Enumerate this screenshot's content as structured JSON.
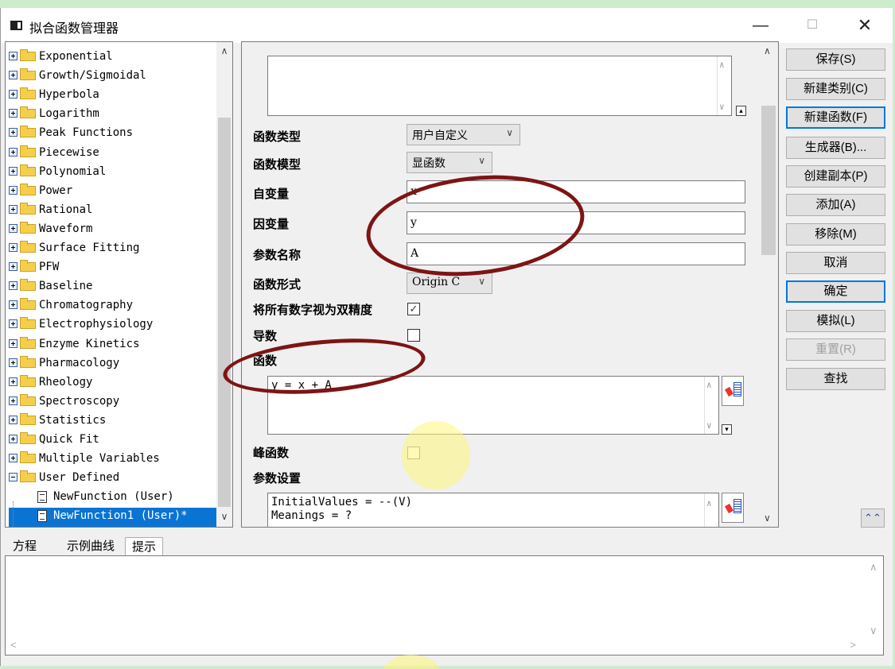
{
  "window": {
    "title": "拟合函数管理器",
    "controls": {
      "minimize": "—",
      "maximize": "☐",
      "close": "✕"
    }
  },
  "tree": {
    "categories": [
      "Exponential",
      "Growth/Sigmoidal",
      "Hyperbola",
      "Logarithm",
      "Peak Functions",
      "Piecewise",
      "Polynomial",
      "Power",
      "Rational",
      "Waveform",
      "Surface Fitting",
      "PFW",
      "Baseline",
      "Chromatography",
      "Electrophysiology",
      "Enzyme Kinetics",
      "Pharmacology",
      "Rheology",
      "Spectroscopy",
      "Statistics",
      "Quick Fit",
      "Multiple Variables",
      "User Defined"
    ],
    "functions": [
      "NewFunction (User)",
      "NewFunction1 (User)*"
    ],
    "selected": "NewFunction1 (User)*"
  },
  "form": {
    "function_type_label": "函数类型",
    "function_type_value": "用户自定义",
    "function_model_label": "函数模型",
    "function_model_value": "显函数",
    "independent_label": "自变量",
    "independent_value": "x",
    "dependent_label": "因变量",
    "dependent_value": "y",
    "param_names_label": "参数名称",
    "param_names_value": "A",
    "function_form_label": "函数形式",
    "function_form_value": "Origin C",
    "double_precision_label": "将所有数字视为双精度",
    "double_precision_checked": true,
    "derivative_label": "导数",
    "derivative_checked": false,
    "function_label": "函数",
    "function_body": "y = x + A",
    "peak_label": "峰函数",
    "peak_checked": false,
    "param_settings_label": "参数设置",
    "param_settings_line1": "InitialValues = --(V)",
    "param_settings_line2": "Meanings = ?"
  },
  "buttons": {
    "save": "保存(S)",
    "new_category": "新建类别(C)",
    "new_function": "新建函数(F)",
    "generator": "生成器(B)...",
    "duplicate": "创建副本(P)",
    "add": "添加(A)",
    "remove": "移除(M)",
    "cancel": "取消",
    "ok": "确定",
    "simulate": "模拟(L)",
    "reset": "重置(R)",
    "find": "查找"
  },
  "tabs": [
    "方程",
    "示例曲线",
    "提示"
  ],
  "active_tab": "提示",
  "colors": {
    "annotation": "#7e1414",
    "selection": "#0a74d4",
    "highlight": "#fff578"
  }
}
